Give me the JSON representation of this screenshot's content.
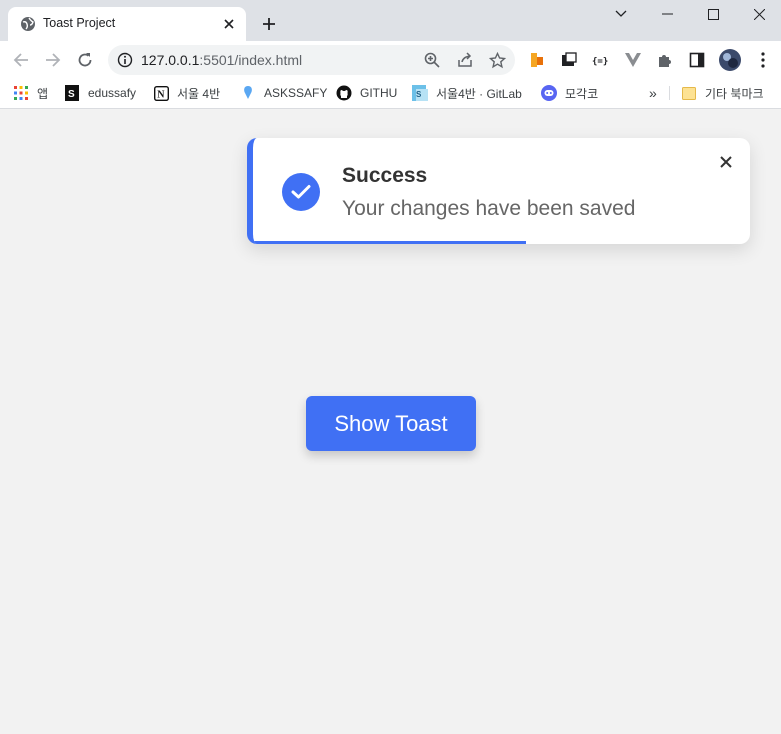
{
  "browser": {
    "tab": {
      "title": "Toast Project"
    },
    "url": {
      "host": "127.0.0.1",
      "rest": ":5501/index.html"
    },
    "bookmarks": [
      {
        "label": "앱",
        "icon": "apps-grid-icon"
      },
      {
        "label": "edussafy",
        "icon": "edussafy-icon"
      },
      {
        "label": "서울 4반",
        "icon": "notion-icon"
      },
      {
        "label": "ASKSSAFY",
        "icon": "pin-icon"
      },
      {
        "label": "GITHU",
        "icon": "github-icon"
      },
      {
        "label": "서울4반 · GitLab",
        "icon": "gitlab-icon"
      },
      {
        "label": "모각코",
        "icon": "discord-icon"
      }
    ],
    "overflow": "»",
    "other_bookmarks": "기타 북마크"
  },
  "toast": {
    "title": "Success",
    "message": "Your changes have been saved",
    "progress_fraction": 0.55,
    "accent": "#4070f4"
  },
  "button": {
    "label": "Show Toast",
    "color": "#4070f4"
  }
}
